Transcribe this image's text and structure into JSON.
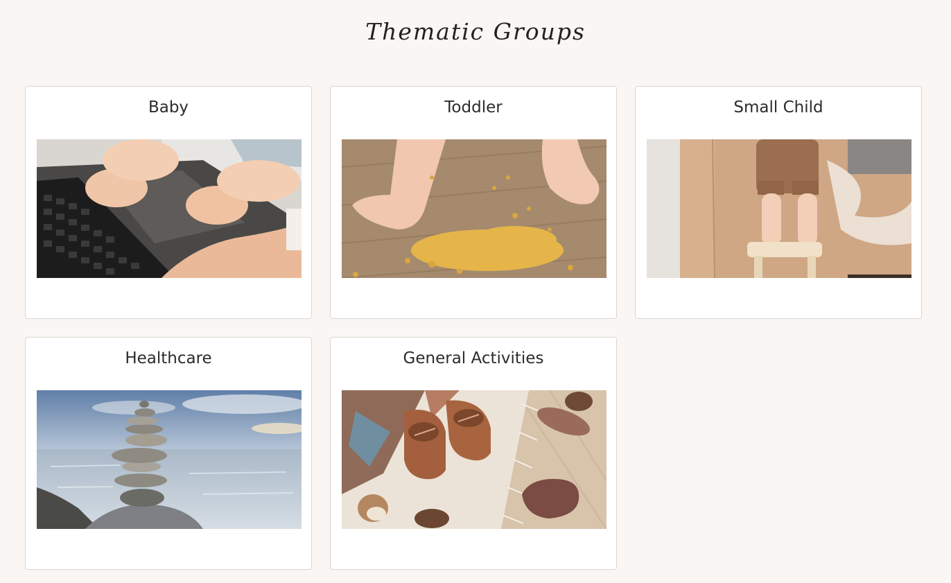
{
  "page": {
    "title": "Thematic Groups",
    "background": "#faf6f3"
  },
  "groups": [
    {
      "title": "Baby",
      "image": "baby-hands-on-laptop"
    },
    {
      "title": "Toddler",
      "image": "toddler-feet-pasta-floor"
    },
    {
      "title": "Small Child",
      "image": "child-standing-on-stool"
    },
    {
      "title": "Healthcare",
      "image": "stone-cairn-by-sea"
    },
    {
      "title": "General Activities",
      "image": "baby-shoes-blanket-wooden-toys"
    }
  ]
}
